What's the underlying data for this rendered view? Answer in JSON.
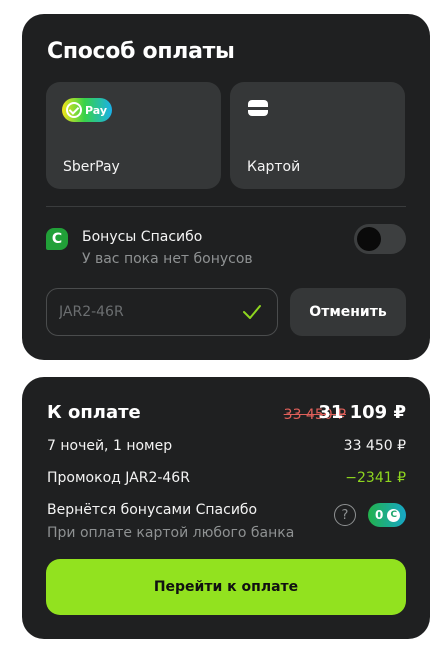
{
  "payment": {
    "title": "Способ оплаты",
    "methods": [
      {
        "label": "SberPay",
        "badge": "Pay"
      },
      {
        "label": "Картой"
      }
    ],
    "bonus": {
      "icon_letter": "C",
      "title": "Бонусы Спасибо",
      "subtitle": "У вас пока нет бонусов",
      "enabled": false
    },
    "promo": {
      "value": "JAR2-46R",
      "cancel_label": "Отменить"
    }
  },
  "summary": {
    "title": "К оплате",
    "old_price": "33 450 ₽",
    "new_price": "31 109 ₽",
    "rows": [
      {
        "label": "7 ночей, 1 номер",
        "value": "33 450 ₽"
      },
      {
        "label": "Промокод JAR2-46R",
        "value": "−2341 ₽"
      }
    ],
    "cashback": {
      "title": "Вернётся бонусами Спасибо",
      "subtitle": "При оплате картой любого банка",
      "help": "?",
      "amount": "0",
      "amount_icon": "C"
    },
    "pay_label": "Перейти к оплате"
  },
  "colors": {
    "accent": "#92e21f",
    "discount": "#8ed61f",
    "old_price": "#e0605a",
    "sber_green": "#21a038"
  }
}
